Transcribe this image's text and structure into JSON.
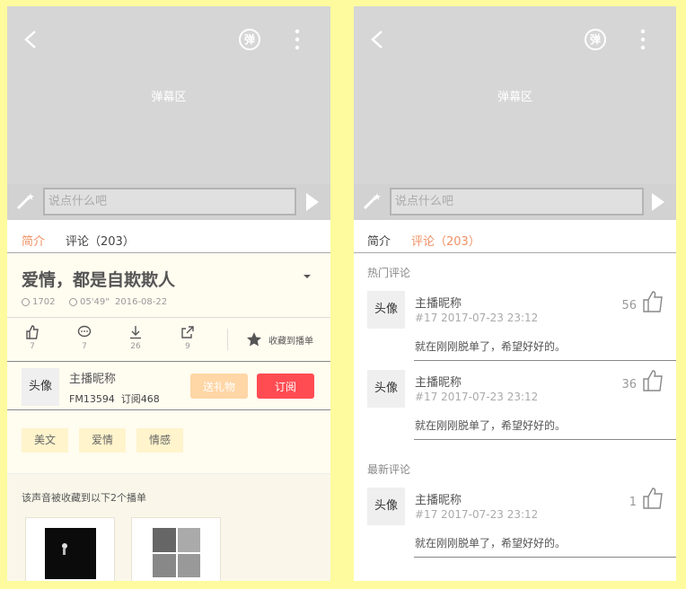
{
  "player": {
    "danmu_area_label": "弹幕区",
    "danmu_toggle_label": "弹",
    "input_placeholder": "说点什么吧"
  },
  "tabs": {
    "intro": "简介",
    "comments": "评论（203）"
  },
  "detail": {
    "title": "爱情，都是自欺欺人",
    "play_count": "1702",
    "duration": "05'49\"",
    "date": "2016-08-22",
    "actions": {
      "like_count": "7",
      "comment_count": "7",
      "download_count": "26",
      "share_count": "9",
      "favorite_label": "收藏到播单"
    },
    "host": {
      "avatar_label": "头像",
      "name": "主播昵称",
      "fm": "FM13594",
      "subs": "订阅468",
      "gift_label": "送礼物",
      "subscribe_label": "订阅"
    },
    "tags": [
      "美文",
      "爱情",
      "情感"
    ],
    "playlist_caption": "该声音被收藏到以下2个播单"
  },
  "comments": {
    "hot_title": "热门评论",
    "latest_title": "最新评论",
    "hot": [
      {
        "avatar": "头像",
        "name": "主播昵称",
        "meta": "#17 2017-07-23 23:12",
        "likes": "56",
        "text": "就在刚刚脱单了，希望好好的。"
      },
      {
        "avatar": "头像",
        "name": "主播昵称",
        "meta": "#17 2017-07-23 23:12",
        "likes": "36",
        "text": "就在刚刚脱单了，希望好好的。"
      }
    ],
    "latest": [
      {
        "avatar": "头像",
        "name": "主播昵称",
        "meta": "#17 2017-07-23 23:12",
        "likes": "1",
        "text": "就在刚刚脱单了，希望好好的。"
      }
    ]
  },
  "colors": {
    "accent": "#ef9164",
    "subscribe": "#ff4c52",
    "gift": "#ffd6a6",
    "background": "#fdfb9e"
  }
}
